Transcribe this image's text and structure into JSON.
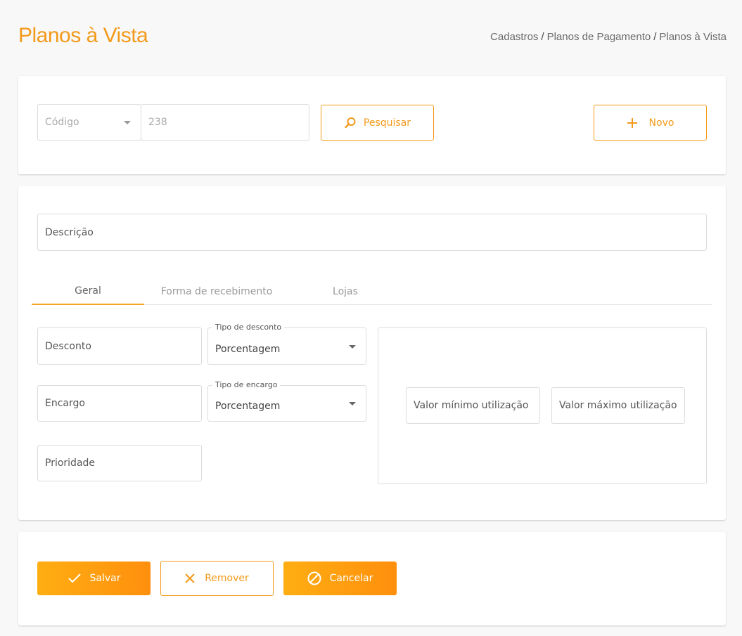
{
  "page": {
    "title": "Planos à Vista"
  },
  "breadcrumb": [
    "Cadastros",
    "Planos de Pagamento",
    "Planos à Vista"
  ],
  "search": {
    "filter_selected": "Código",
    "value": "238",
    "search_label": "Pesquisar",
    "new_label": "Novo"
  },
  "form": {
    "description_label": "Descrição",
    "tabs": [
      "Geral",
      "Forma de recebimento",
      "Lojas"
    ],
    "discount_label": "Desconto",
    "discount_type_label": "Tipo de desconto",
    "discount_type_value": "Porcentagem",
    "charge_label": "Encargo",
    "charge_type_label": "Tipo de encargo",
    "charge_type_value": "Porcentagem",
    "priority_label": "Prioridade",
    "min_value_label": "Valor mínimo utilização",
    "max_value_label": "Valor máximo utilização"
  },
  "actions": {
    "save_label": "Salvar",
    "remove_label": "Remover",
    "cancel_label": "Cancelar"
  },
  "colors": {
    "accent": "#f39a1b",
    "gradient_start": "#ffae12",
    "gradient_end": "#ff8f0d"
  }
}
